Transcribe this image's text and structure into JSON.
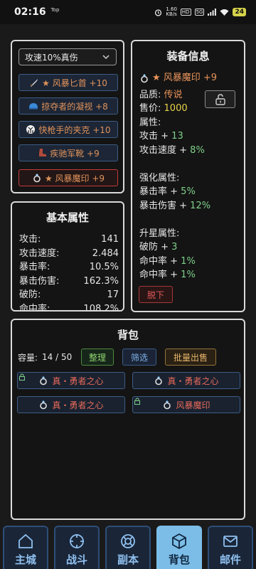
{
  "status_bar": {
    "time": "02:16",
    "top_tag": "Top",
    "speed_value": "1.60",
    "speed_unit": "KB/s",
    "hd_tag": "HD",
    "net_tag": "5G",
    "battery": "24"
  },
  "equip_list": {
    "dropdown_value": "攻速10%真伤",
    "items": [
      {
        "label": "★ 风暴匕首 +10",
        "icon": "dagger-icon"
      },
      {
        "label": "掠夺者的凝视 +8",
        "icon": "helmet-icon"
      },
      {
        "label": "快枪手的夹克 +10",
        "icon": "jacket-icon"
      },
      {
        "label": "疾驰军靴 +9",
        "icon": "boot-icon"
      },
      {
        "label": "★ 风暴魔印 +9",
        "icon": "ring-icon",
        "selected": true
      }
    ]
  },
  "stats": {
    "title": "基本属性",
    "rows": [
      {
        "label": "攻击:",
        "value": "141"
      },
      {
        "label": "攻击速度:",
        "value": "2.484"
      },
      {
        "label": "暴击率:",
        "value": "10.5%"
      },
      {
        "label": "暴击伤害:",
        "value": "162.3%"
      },
      {
        "label": "破防:",
        "value": "17"
      },
      {
        "label": "命中率:",
        "value": "108.2%"
      }
    ]
  },
  "equip_info": {
    "title": "装备信息",
    "item_name": "★ 风暴魔印 +9",
    "quality_label": "品质:",
    "quality_value": "传说",
    "price_label": "售价:",
    "price_value": "1000",
    "attr_header": "属性:",
    "attrs": [
      {
        "label": "攻击 + ",
        "value": "13"
      },
      {
        "label": "攻击速度 + ",
        "value": "8%"
      }
    ],
    "enhance_header": "强化属性:",
    "enhance": [
      {
        "label": "暴击率 + ",
        "value": "5%"
      },
      {
        "label": "暴击伤害 + ",
        "value": "12%"
      }
    ],
    "star_header": "升星属性:",
    "star": [
      {
        "label": "破防 + ",
        "value": "3"
      },
      {
        "label": "命中率 + ",
        "value": "1%"
      },
      {
        "label": "命中率 + ",
        "value": "1%"
      }
    ],
    "unequip_label": "脱下"
  },
  "backpack": {
    "title": "背包",
    "capacity_label": "容量:",
    "capacity_value": "14 / 50",
    "sort_label": "整理",
    "filter_label": "筛选",
    "bulk_sell_label": "批量出售",
    "items": [
      {
        "label": "真・勇者之心",
        "locked": true
      },
      {
        "label": "真・勇者之心",
        "locked": false
      },
      {
        "label": "真・勇者之心",
        "locked": false
      },
      {
        "label": "风暴魔印",
        "locked": true
      }
    ]
  },
  "tabs": [
    {
      "label": "主城",
      "icon": "home-icon"
    },
    {
      "label": "战斗",
      "icon": "crosshair-icon"
    },
    {
      "label": "副本",
      "icon": "lifebuoy-icon"
    },
    {
      "label": "背包",
      "icon": "package-icon",
      "active": true
    },
    {
      "label": "邮件",
      "icon": "mail-icon"
    }
  ],
  "colors": {
    "legendary": "#e8935a",
    "price": "#e8d44a",
    "bonus": "#7ed08a",
    "active_tab": "#7cbde8"
  }
}
